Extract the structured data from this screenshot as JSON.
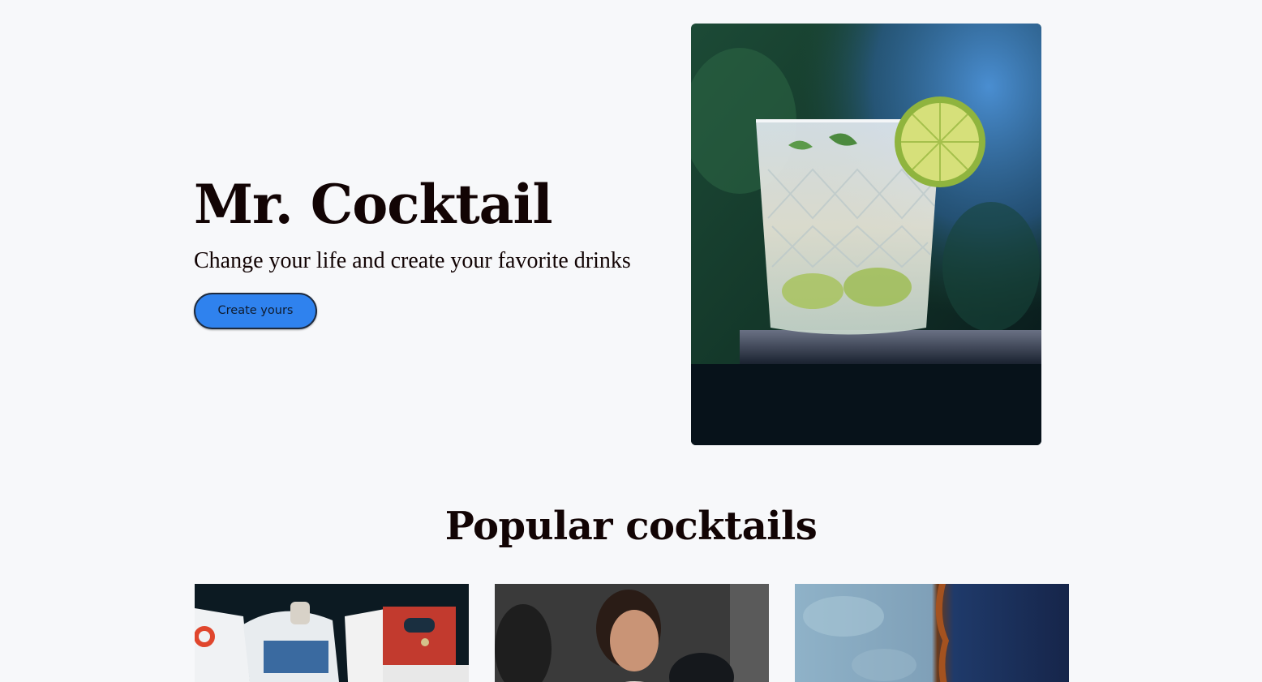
{
  "hero": {
    "title": "Mr. Cocktail",
    "subtitle": "Change your life and create your favorite drinks",
    "cta_label": "Create yours",
    "image_subject": "cocktail glass with lime and mint"
  },
  "popular": {
    "title": "Popular cocktails",
    "cards": [
      {
        "image_subject": "boats in harbor"
      },
      {
        "image_subject": "woman boxing"
      },
      {
        "image_subject": "blue rusted metal texture"
      }
    ]
  },
  "colors": {
    "background": "#f7f8fa",
    "text": "#120404",
    "accent": "#2f82ee"
  }
}
